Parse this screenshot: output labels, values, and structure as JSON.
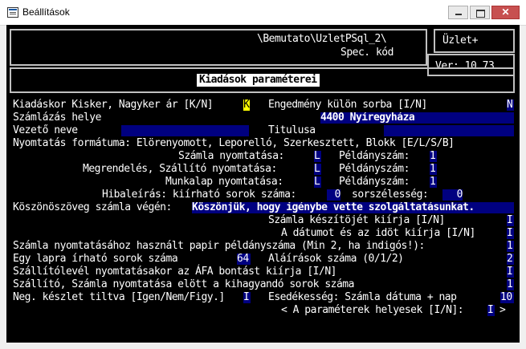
{
  "window": {
    "title": "Beállítások",
    "minimize_label": "—",
    "maximize_label": "",
    "close_label": "✕"
  },
  "header": {
    "path": "\\Bemutato\\UzletPSql_2\\",
    "code_label": "Spec. kód",
    "module": "Üzlet+",
    "version": "Ver: 10.73",
    "screen_title": "Kiadások paraméterei"
  },
  "form": {
    "kiadaskor_label": "Kiadáskor Kisker, Nagyker ár [K/N]",
    "kiadaskor_value": "K",
    "engedmeny_label": "Engedmény külön sorba [I/N]",
    "engedmeny_value": "N",
    "szamlazas_helye_label": "Számlázás helye",
    "szamlazas_helye_value": "4400 Nyíregyháza",
    "vezeto_neve_label": "Vezető neve",
    "vezeto_neve_value": "",
    "titulusa_label": "Titulusa",
    "titulusa_value": "",
    "nyomtatas_formatuma_label": "Nyomtatás formátuma: Elörenyomott, Leporelló, Szerkesztett, Blokk [E/L/S/B]",
    "szamla_nyomtatasa_label": "Számla nyomtatása:",
    "szamla_nyomtatasa_value": "L",
    "szamla_peldanyszam_label": "Példányszám:",
    "szamla_peldanyszam_value": "1",
    "megrendeles_label": "Megrendelés, Szállító nyomtatása:",
    "megrendeles_value": "L",
    "megrendeles_peldanyszam_label": "Példányszám:",
    "megrendeles_peldanyszam_value": "1",
    "munkalap_label": "Munkalap nyomtatása:",
    "munkalap_value": "L",
    "munkalap_peldanyszam_label": "Példányszám:",
    "munkalap_peldanyszam_value": "1",
    "hibaleiras_label": "Hibaleírás: kiírható sorok száma:",
    "hibaleiras_value": "0",
    "sorszelesseg_label": "sorszélesség:",
    "sorszelesseg_value": "0",
    "koszonoszoveg_label": "Köszönöszöveg számla végén:",
    "koszonoszoveg_value": "Köszönjük, hogy igénybe vette szolgáltatásunkat.",
    "keszitojet_label": "Számla készítöjét kiírja [I/N]",
    "keszitojet_value": "I",
    "datumot_label": "A dátumot és az idöt kiírja [I/N]",
    "datumot_value": "I",
    "papir_label": "Számla nyomtatásához használt papir példányszáma (Min 2, ha indigós!):",
    "papir_value": "1",
    "sorok_label": "Egy lapra írható sorok száma",
    "sorok_value": "64",
    "alairasok_label": "Aláírások száma (0/1/2)",
    "alairasok_value": "2",
    "afa_label": "Szállítólevél nyomtatásakor az ÁFA bontást kiírja [I/N]",
    "afa_value": "I",
    "kihagyando_label": "Szállító, Számla nyomtatása elött a kihagyandó sorok száma",
    "kihagyando_value": "1",
    "neg_keszlet_label": "Neg. készlet tiltva [Igen/Nem/Figy.]",
    "neg_keszlet_value": "I",
    "esedekesseg_label": "Esedékesség: Számla dátuma + nap",
    "esedekesseg_value": "10",
    "parameterek_label": "< A paraméterek helyesek [I/N]:",
    "parameterek_value": "I",
    "parameterek_suffix": ">"
  }
}
